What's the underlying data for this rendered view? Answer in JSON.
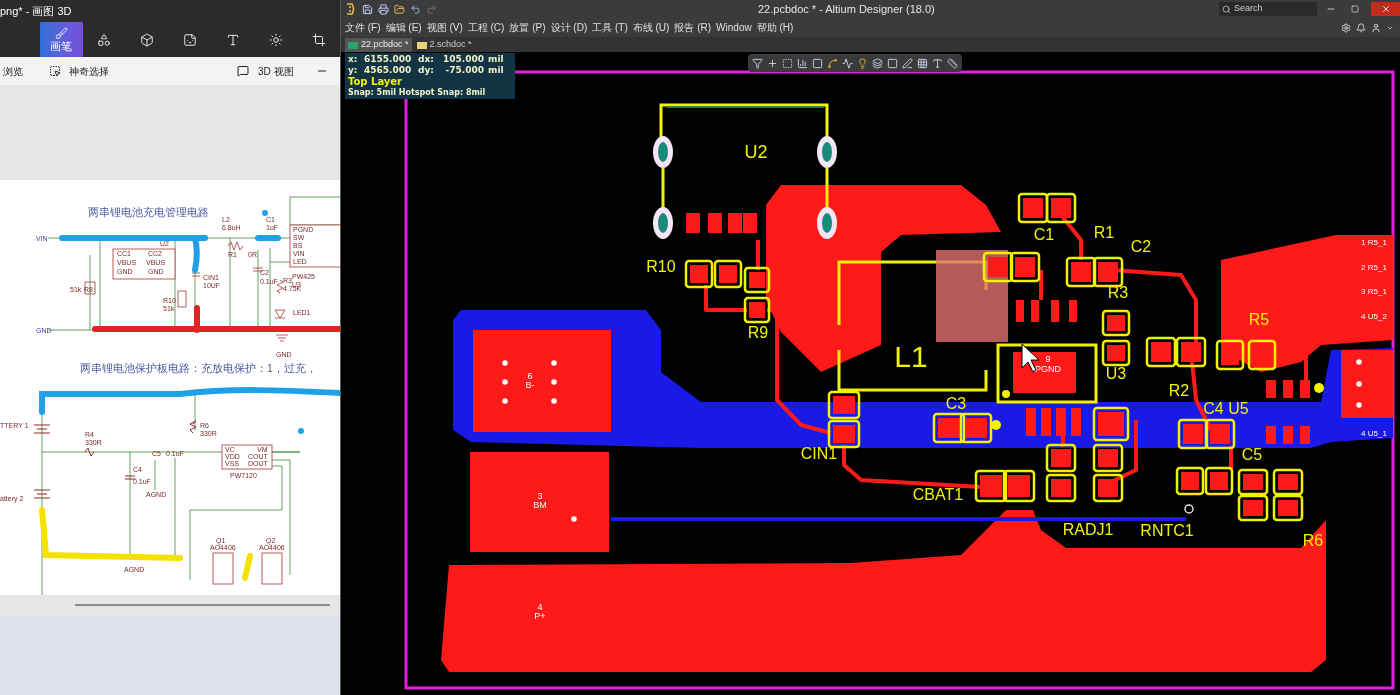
{
  "paint": {
    "title": "png* - 画图 3D",
    "tools": [
      {
        "label": "画笔",
        "selected": true
      },
      {
        "selected": false
      },
      {
        "selected": false
      },
      {
        "selected": false
      },
      {
        "selected": false
      },
      {
        "selected": false
      },
      {
        "selected": false
      }
    ],
    "actions": [
      {
        "label": "浏览"
      },
      {
        "label": "神奇选择"
      },
      {
        "label": "3D 视图"
      }
    ],
    "schematic": {
      "titles": [
        "两串锂电池充电管理电路",
        "两串锂电池保护板电路：充放电保护：1，过充，"
      ],
      "labels": [
        "VIN",
        "GND",
        "L2",
        "6.8uH",
        "C1",
        "1uF",
        "R1",
        "0R",
        "U2",
        "CC1",
        "CC2",
        "VBUS",
        "VBUS",
        "GND",
        "GND",
        "51k",
        "R8",
        "CIN1",
        "10UF",
        "C2",
        "0.1uF",
        "R3",
        "4.75K",
        "LED1",
        "R10",
        "51k",
        "GND",
        "PGND",
        "SW",
        "BS",
        "VIN",
        "LED",
        "PW425",
        "U3",
        "TTERY 1",
        "attery 2",
        "R4",
        "330R",
        "R6",
        "330R",
        "C4",
        "0.1uF",
        "C5",
        "0.1uF",
        "VC",
        "VDD",
        "VSS",
        "VM",
        "COUT",
        "DOUT",
        "PW7120",
        "AGND",
        "AGND",
        "Q1",
        "AO4406",
        "Q2",
        "AO4406"
      ]
    }
  },
  "altium": {
    "title": "22.pcbdoc * - Altium Designer (18.0)",
    "search": {
      "placeholder": "Search"
    },
    "menus": [
      "文件 (F)",
      "编辑 (E)",
      "视图 (V)",
      "工程 (C)",
      "放置 (P)",
      "设计 (D)",
      "工具 (T)",
      "布线 (U)",
      "报告 (R)",
      "Window",
      "帮助 (H)"
    ],
    "tabs": [
      {
        "label": "22.pcbdoc *",
        "selected": true
      },
      {
        "label": "2.schdoc *",
        "selected": false
      }
    ],
    "hud": {
      "rows": [
        {
          "axis": "x:",
          "value": "6155.000",
          "delta_label": "dx:",
          "delta": "105.000",
          "unit": "mil"
        },
        {
          "axis": "y:",
          "value": "4565.000",
          "delta_label": "dy:",
          "delta": "-75.000",
          "unit": "mil"
        }
      ],
      "layer": "Top Layer",
      "snap": "Snap: 5mil Hotspot Snap: 8mil"
    },
    "pcb": {
      "designators": [
        "U2",
        "C1",
        "R1",
        "C2",
        "R10",
        "R3",
        "R9",
        "L1",
        "U3",
        "R5",
        "R2",
        "C4 U5",
        "C3",
        "CIN1",
        "C5",
        "CBAT1",
        "RADJ1",
        "RNTC1",
        "R6"
      ],
      "pad_labels": [
        "6",
        "B-",
        "3",
        "BM",
        "4",
        "P+",
        "9",
        "PGND",
        "1 R5_1",
        "2 R5_1",
        "3 R5_1",
        "4 U5_2",
        "4 U5_1"
      ]
    }
  }
}
